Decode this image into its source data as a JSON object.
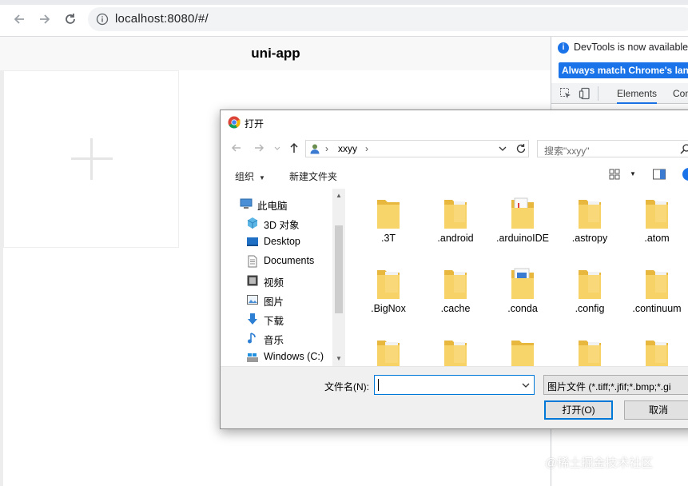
{
  "browser": {
    "url": "localhost:8080/#/",
    "icons": [
      "back-arrow-icon",
      "forward-arrow-icon",
      "reload-icon",
      "site-info-icon"
    ]
  },
  "page": {
    "title": "uni-app",
    "upload_icon": "plus-icon"
  },
  "devtools": {
    "info_message": "DevTools is now available in",
    "match_button": "Always match Chrome's language",
    "tabs": [
      "Elements",
      "Console"
    ],
    "active_tab": "Elements"
  },
  "dialog": {
    "title": "打开",
    "address": {
      "path": [
        "xxyy"
      ],
      "search_placeholder": "搜索\"xxyy\""
    },
    "commands": {
      "organize": "组织",
      "new_folder": "新建文件夹"
    },
    "nav_items": [
      {
        "label": "此电脑",
        "icon": "computer-icon"
      },
      {
        "label": "3D 对象",
        "icon": "cube-3d-icon"
      },
      {
        "label": "Desktop",
        "icon": "desktop-icon"
      },
      {
        "label": "Documents",
        "icon": "documents-icon"
      },
      {
        "label": "视频",
        "icon": "video-icon"
      },
      {
        "label": "图片",
        "icon": "picture-icon"
      },
      {
        "label": "下载",
        "icon": "download-icon"
      },
      {
        "label": "音乐",
        "icon": "music-icon"
      },
      {
        "label": "Windows (C:)",
        "icon": "drive-icon"
      }
    ],
    "files": [
      {
        "name": ".3T"
      },
      {
        "name": ".android"
      },
      {
        "name": ".arduinoIDE"
      },
      {
        "name": ".astropy"
      },
      {
        "name": ".atom"
      },
      {
        "name": ".BigNox"
      },
      {
        "name": ".cache"
      },
      {
        "name": ".conda"
      },
      {
        "name": ".config"
      },
      {
        "name": ".continuum"
      },
      {
        "name": ""
      },
      {
        "name": ""
      },
      {
        "name": ""
      },
      {
        "name": ""
      },
      {
        "name": ""
      }
    ],
    "filename_label": "文件名(N):",
    "filename_value": "",
    "filter": "图片文件 (*.tiff;*.jfif;*.bmp;*.gi",
    "open_button": "打开(O)",
    "cancel_button": "取消"
  },
  "watermark": "@稀土掘金技术社区",
  "colors": {
    "accent": "#1a73e8",
    "dialog_focus": "#0078d7",
    "folder": "#f5c542"
  }
}
